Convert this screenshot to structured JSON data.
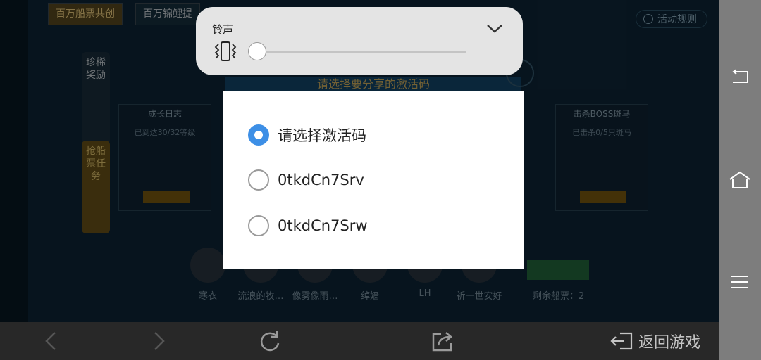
{
  "volume_panel": {
    "label": "铃声",
    "level": 0
  },
  "dialog": {
    "options": [
      {
        "label": "请选择激活码",
        "checked": true
      },
      {
        "label": "0tkdCn7Srv",
        "checked": false
      },
      {
        "label": "0tkdCn7Srw",
        "checked": false
      }
    ]
  },
  "background": {
    "top_tabs": [
      "百万船票共创",
      "百万锦鲤提"
    ],
    "rules_label": "活动规则",
    "side_tabs": [
      "珍稀奖励",
      "抢船票任务"
    ],
    "panel_title": "请选择要分享的激活码",
    "cards": [
      {
        "title": "成长日志",
        "desc": "已到达30/32等级"
      },
      {
        "title": "击杀BOSS斑马",
        "desc": "已击杀0/5只斑马"
      }
    ],
    "friends": [
      "寒衣",
      "流浪的牧…",
      "像雾像雨…",
      "绰嫱",
      "LH",
      "祈一世安好"
    ],
    "remaining": "剩余船票：2"
  },
  "bottom_bar": {
    "back_label": "返回游戏"
  },
  "colors": {
    "accent": "#3d8fe6",
    "dialog_bg": "#ffffff",
    "panel_bg": "#e4e4e4",
    "nav_bg": "#7d7d7d"
  }
}
